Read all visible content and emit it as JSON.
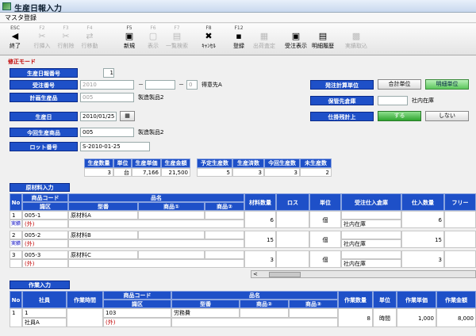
{
  "window": {
    "title": "生産日報入力"
  },
  "menu": {
    "label": "マスタ登録"
  },
  "toolbar": [
    {
      "key": "ESC",
      "label": "終了",
      "icon": "exit-icon",
      "glyph": "◀",
      "enabled": true
    },
    {
      "key": "F2",
      "label": "行挿入",
      "icon": "insert-row-icon",
      "glyph": "✂",
      "enabled": false
    },
    {
      "key": "F3",
      "label": "行削除",
      "icon": "delete-row-icon",
      "glyph": "✂",
      "enabled": false
    },
    {
      "key": "F4",
      "label": "行移動",
      "icon": "move-row-icon",
      "glyph": "⇄",
      "enabled": false
    },
    {
      "key": "F5",
      "label": "新規",
      "icon": "new-icon",
      "glyph": "▣",
      "enabled": true
    },
    {
      "key": "F6",
      "label": "表示",
      "icon": "view-icon",
      "glyph": "▢",
      "enabled": false
    },
    {
      "key": "F7",
      "label": "一覧検索",
      "icon": "list-search-icon",
      "glyph": "▤",
      "enabled": false
    },
    {
      "key": "F8",
      "label": "ｷｬﾝｾﾙ",
      "icon": "cancel-icon",
      "glyph": "✖",
      "enabled": true
    },
    {
      "key": "F12",
      "label": "登録",
      "icon": "save-icon",
      "glyph": "▪",
      "enabled": true
    },
    {
      "key": "",
      "label": "出荷査定",
      "icon": "shipping-icon",
      "glyph": "▦",
      "enabled": false
    },
    {
      "key": "",
      "label": "受注表示",
      "icon": "order-view-icon",
      "glyph": "▣",
      "enabled": true
    },
    {
      "key": "",
      "label": "明細履歴",
      "icon": "history-icon",
      "glyph": "▤",
      "enabled": true
    },
    {
      "key": "",
      "label": "実績取込",
      "icon": "import-icon",
      "glyph": "▩",
      "enabled": false
    }
  ],
  "form": {
    "status": "修正モード",
    "lbl_nippou": "生産日報番号",
    "nippou_val": "1",
    "lbl_juchu": "受注番号",
    "juchu_val": "2010",
    "juchu_mid": "",
    "juchu_small": "0",
    "tokuisaki": "得意先A",
    "lbl_hinmoku": "計画生産品",
    "hinmoku_code": "005",
    "hinmoku_name": "製造製品2",
    "lbl_date": "生産日",
    "date_val": "2010/01/25",
    "lbl_today": "今回生産商品",
    "today_code": "005",
    "today_name": "製造製品2",
    "lbl_lot": "ロット番号",
    "lot_val": "S-2010-01-25",
    "lbl_calc": "発注計算単位",
    "btn_total": "合計単位",
    "btn_detail": "明細単位",
    "lbl_dest": "保管先倉庫",
    "dest_code": "",
    "dest_name": "社内在庫",
    "lbl_reflect": "仕掛残計上",
    "btn_yes": "する",
    "btn_no": "しない"
  },
  "summary": {
    "headers": [
      "生産数量",
      "単位",
      "生産単価",
      "生産金額"
    ],
    "values": [
      "3",
      "台",
      "7,166",
      "21,500"
    ],
    "headers2": [
      "予定生産数",
      "生産済数",
      "今回生産数",
      "未生産数"
    ],
    "values2": [
      "5",
      "3",
      "3",
      "2"
    ]
  },
  "materials": {
    "title": "原材料入力",
    "headers": {
      "no": "No",
      "code": "商品コード",
      "type": "識区",
      "name": "品名",
      "spec": "型番",
      "sub1": "商品①",
      "sub2": "商品②",
      "qty": "材料数量",
      "loss": "ロス",
      "unit": "単位",
      "wh": "受注仕入倉庫",
      "stock": "仕入数量",
      "free": "フリー"
    },
    "rows": [
      {
        "no": "1",
        "status": "実績",
        "code": "005-1",
        "kind": "(外)",
        "name": "原材料A",
        "qty": "6",
        "unit": "個",
        "wh": "社内在庫",
        "stock": "6"
      },
      {
        "no": "2",
        "status": "実績",
        "code": "005-2",
        "kind": "(外)",
        "name": "原材料B",
        "qty": "15",
        "unit": "個",
        "wh": "社内在庫",
        "stock": "15"
      },
      {
        "no": "3",
        "status": "",
        "code": "005-3",
        "kind": "(外)",
        "name": "原材料C",
        "qty": "3",
        "unit": "個",
        "wh": "社内在庫",
        "stock": "3"
      }
    ]
  },
  "work": {
    "title": "作業入力",
    "headers": {
      "no": "No",
      "staff": "社員",
      "time": "作業時間",
      "code": "商品コード",
      "type": "識区",
      "name": "品名",
      "spec": "型番",
      "sub1": "商品②",
      "sub2": "商品③",
      "qty": "作業数量",
      "unit": "単位",
      "price": "作業単価",
      "amount": "作業金額"
    },
    "rows": [
      {
        "no": "1",
        "staff_code": "1",
        "staff": "社員A",
        "code": "103",
        "kind": "(外)",
        "name": "労務費",
        "qty": "8",
        "unit": "時間",
        "price": "1,000",
        "amount": "8,000"
      }
    ]
  }
}
